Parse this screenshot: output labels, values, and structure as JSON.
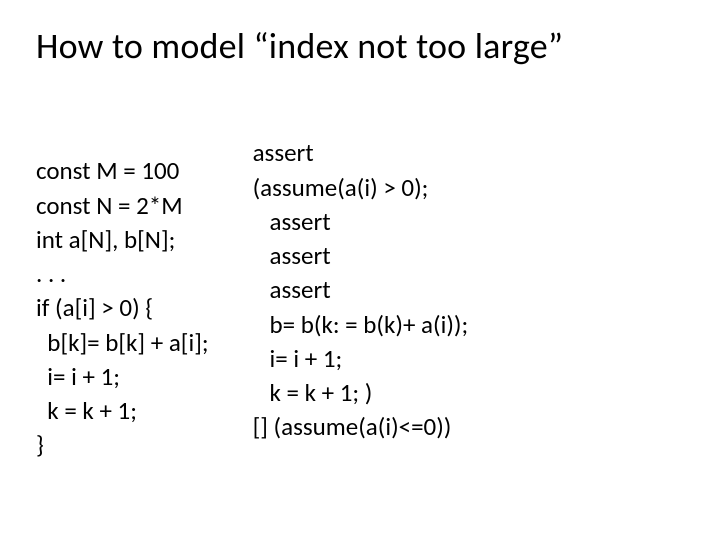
{
  "title": "How to model “index not too large”",
  "left": {
    "l0": "const M = 100",
    "l1": "const N = 2*M",
    "l2": "int a[N], b[N];",
    "l3": ". . .",
    "l4": "if (a[i] > 0) {",
    "l5": "  b[k]= b[k] + a[i];",
    "l6": "  i= i + 1;",
    "l7": "  k = k + 1;",
    "l8": "}"
  },
  "right": {
    "r0": "assert",
    "r1": "(assume(a(i) > 0);",
    "r2": "   assert",
    "r3": "   assert",
    "r4": "   assert",
    "r5": "   b= b(k: = b(k)+ a(i));",
    "r6": "   i= i + 1;",
    "r7": "   k = k + 1; )",
    "r8": "[] (assume(a(i)<=0))"
  }
}
